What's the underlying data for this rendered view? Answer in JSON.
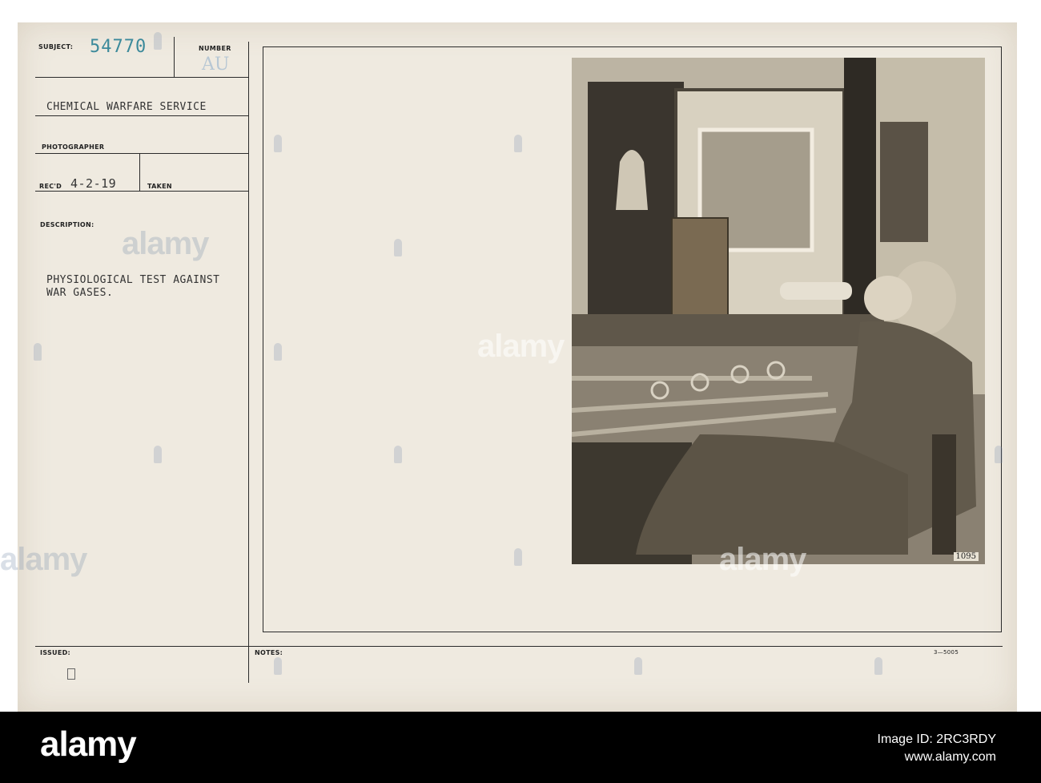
{
  "card": {
    "subject_label": "SUBJECT:",
    "subject_number": "54770",
    "number_label": "NUMBER",
    "number_value": "AU",
    "service": "CHEMICAL WARFARE SERVICE",
    "photographer_label": "PHOTOGRAPHER",
    "recd_label": "REC'D",
    "recd_date": "4-2-19",
    "taken_label": "TAKEN",
    "description_label": "DESCRIPTION:",
    "description_line1": "PHYSIOLOGICAL TEST AGAINST",
    "description_line2": "WAR GASES.",
    "issued_label": "ISSUED:",
    "notes_label": "NOTES:",
    "form_code": "3—5005",
    "photo_id": "1095"
  },
  "watermark": {
    "text": "alamy"
  },
  "footer": {
    "brand": "alamy",
    "image_id_label": "Image ID: 2RC3RDY",
    "site": "www.alamy.com"
  }
}
